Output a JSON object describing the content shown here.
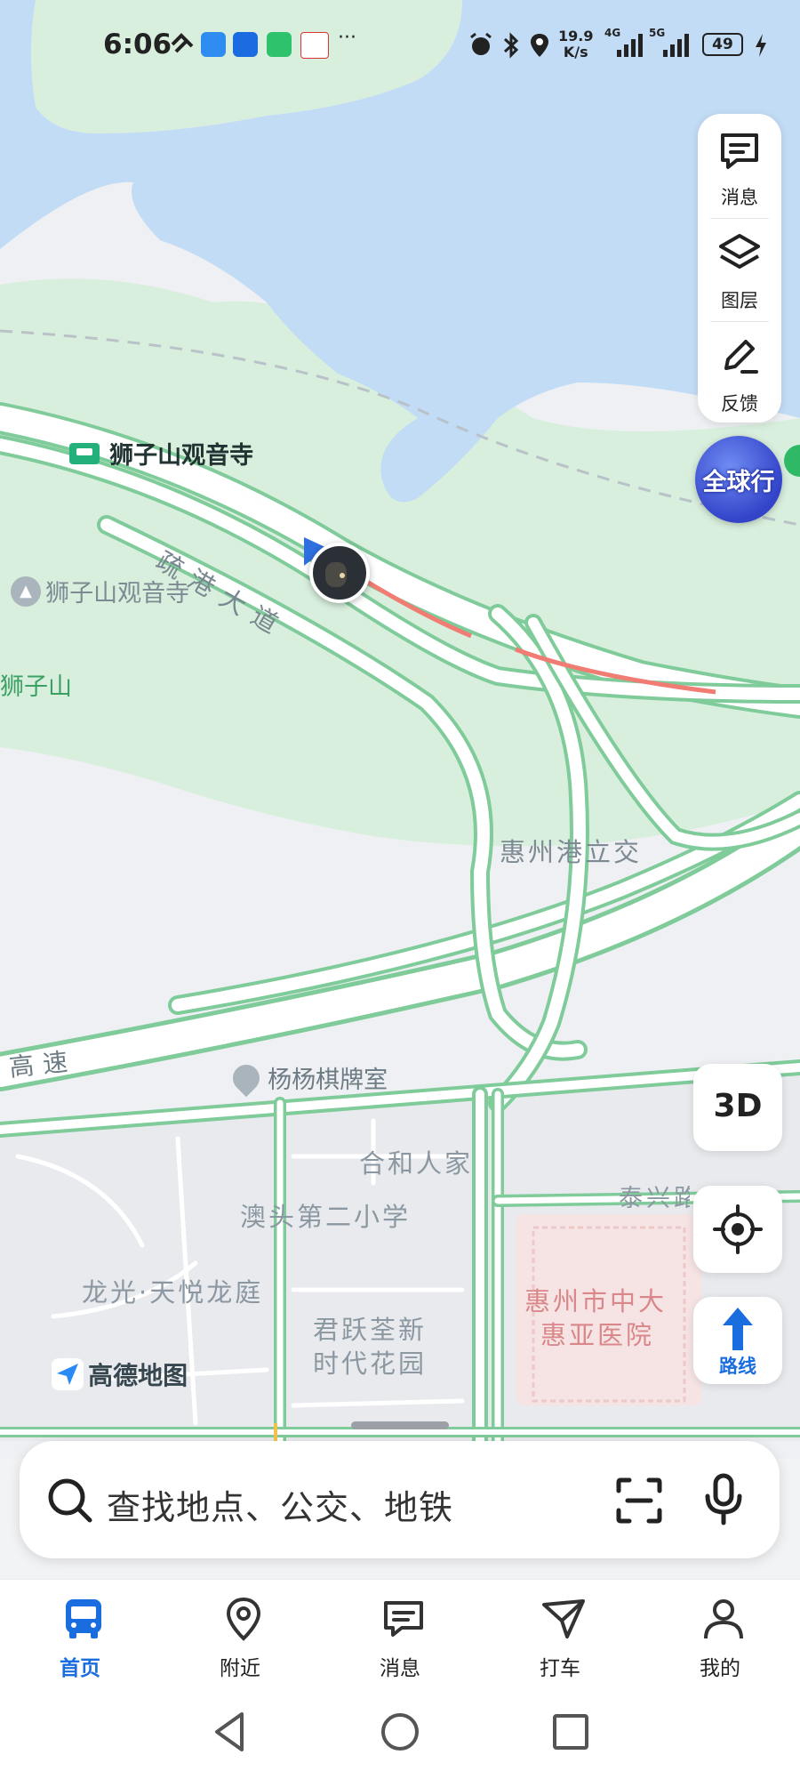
{
  "status_bar": {
    "time": "6:06",
    "net_rate_value": "19.9",
    "net_rate_unit": "K/s",
    "battery": "49",
    "signal_1": "4G",
    "signal_2": "5G"
  },
  "side_panel": {
    "messages_label": "消息",
    "layers_label": "图层",
    "feedback_label": "反馈"
  },
  "global_badge": "全球行",
  "map_labels": {
    "shizishan_temple_1": "狮子山观音寺",
    "shugang_road": "疏港大道",
    "shizishan_temple_2": "狮子山观音寺",
    "shizishan": "狮子山",
    "huizhou_interchange": "惠州港立交",
    "highway": "高速",
    "yangyang_chess": "杨杨棋牌室",
    "hehe_family": "合和人家",
    "aotou_school": "澳头第二小学",
    "longguang": "龙光·天悦龙庭",
    "junyue_1": "君跃荃新",
    "junyue_2": "时代花园",
    "hospital_1": "惠州市中大",
    "hospital_2": "惠亚医院",
    "taixing_road": "泰兴路",
    "brand": "高德地图"
  },
  "buttons": {
    "three_d": "3D",
    "route": "路线"
  },
  "search": {
    "placeholder": "查找地点、公交、地铁"
  },
  "tabs": [
    {
      "label": "首页",
      "active": true
    },
    {
      "label": "附近",
      "active": false
    },
    {
      "label": "消息",
      "active": false
    },
    {
      "label": "打车",
      "active": false
    },
    {
      "label": "我的",
      "active": false
    }
  ],
  "colors": {
    "water": "#c3dcf6",
    "park": "#d8eedc",
    "road_border": "#7fcb9a",
    "traffic_slow": "#f07c74",
    "accent_blue": "#1a6ddf"
  }
}
